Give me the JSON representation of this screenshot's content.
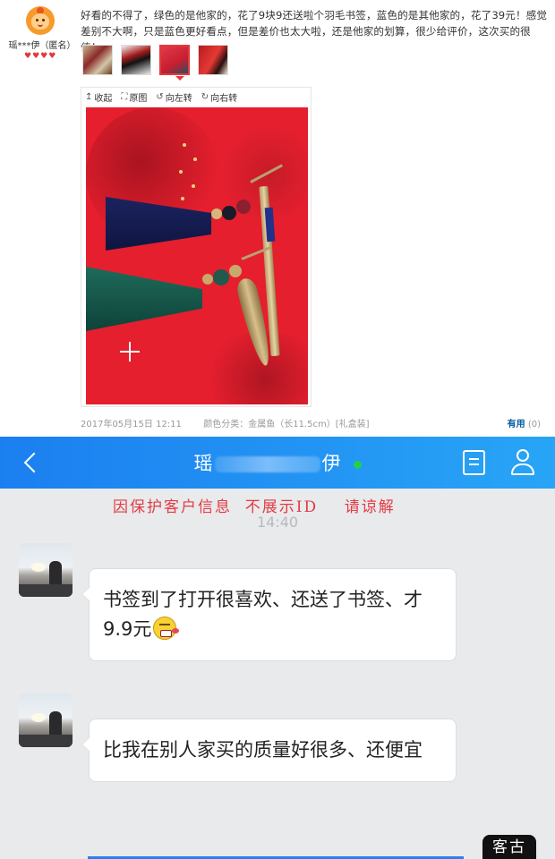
{
  "review": {
    "username": "瑶***伊（匿名）",
    "text": "好看的不得了，绿色的是他家的，花了9块9还送啦个羽毛书签，蓝色的是其他家的，花了39元！感觉差别不大啊，只是蓝色更好看点，但是差价也太大啦，还是他家的划算，很少给评价，这次买的很值！",
    "toolbar": {
      "collapse": "收起",
      "original": "原图",
      "rotate_left": "向左转",
      "rotate_right": "向右转"
    },
    "date": "2017年05月15日 12:11",
    "variant": "颜色分类：金属鱼（长11.5cm）[礼盒装]",
    "useful_label": "有用",
    "useful_count": "(0)"
  },
  "chat": {
    "contact_name_start": "瑶",
    "contact_name_end": "伊",
    "notice": "因保护客户信息  不展示ID    请谅解",
    "time": "14:40",
    "messages": [
      {
        "text": "书签到了打开很喜欢、还送了书签、才9.9元"
      },
      {
        "text": "比我在别人家买的质量好很多、还便宜"
      }
    ],
    "stamp": "客古"
  },
  "colors": {
    "nav_start": "#1b7ff0",
    "nav_end": "#28a5f6",
    "notice": "#e23b44",
    "online": "#21d14a",
    "link": "#005aa0"
  },
  "icons": [
    "back-icon",
    "document-icon",
    "profile-icon",
    "rotate-left-icon",
    "rotate-right-icon",
    "fullsize-icon",
    "collapse-icon",
    "smiley-emoji"
  ]
}
